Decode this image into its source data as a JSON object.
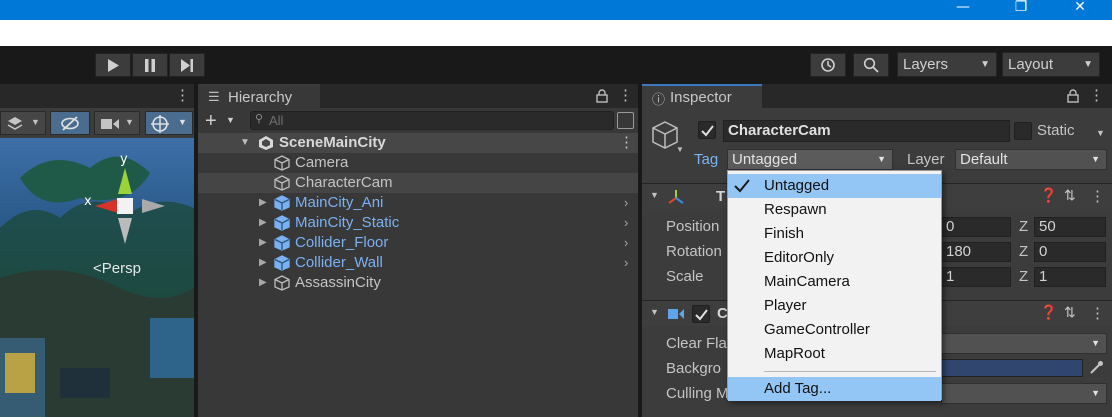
{
  "window": {
    "minimize_glyph": "—",
    "maximize_glyph": "❐",
    "close_glyph": "✕"
  },
  "toolbar": {
    "layers_label": "Layers",
    "layout_label": "Layout"
  },
  "scene": {
    "axis_y": "y",
    "axis_x": "x",
    "persp_label": "<Persp"
  },
  "hierarchy": {
    "tab_label": "Hierarchy",
    "search_placeholder": "All",
    "scene_name": "SceneMainCity",
    "items": [
      {
        "label": "Camera",
        "prefab": false,
        "expandable": false
      },
      {
        "label": "CharacterCam",
        "prefab": false,
        "expandable": false,
        "selected": true
      },
      {
        "label": "MainCity_Ani",
        "prefab": true,
        "expandable": true
      },
      {
        "label": "MainCity_Static",
        "prefab": true,
        "expandable": true
      },
      {
        "label": "Collider_Floor",
        "prefab": true,
        "expandable": true
      },
      {
        "label": "Collider_Wall",
        "prefab": true,
        "expandable": true
      },
      {
        "label": "AssassinCity",
        "prefab": false,
        "expandable": true
      }
    ]
  },
  "inspector": {
    "tab_label": "Inspector",
    "object_name": "CharacterCam",
    "static_label": "Static",
    "tag_label": "Tag",
    "tag_value": "Untagged",
    "layer_label": "Layer",
    "layer_value": "Default",
    "transform": {
      "header_initial": "T",
      "position_label": "Position",
      "rotation_label": "Rotation",
      "scale_label": "Scale",
      "position_y": "0",
      "position_z": "50",
      "rotation_y": "180",
      "rotation_z": "0",
      "scale_y": "1",
      "scale_z": "1",
      "z_label": "Z"
    },
    "camera": {
      "header_initial": "C",
      "clear_flags_label": "Clear Fla",
      "background_label": "Backgro",
      "culling_label": "Culling M"
    }
  },
  "tag_menu": {
    "items": [
      "Untagged",
      "Respawn",
      "Finish",
      "EditorOnly",
      "MainCamera",
      "Player",
      "GameController",
      "MapRoot"
    ],
    "selected_index": 0,
    "add_tag_label": "Add Tag..."
  },
  "colors": {
    "accent": "#0078d7",
    "selection": "#93c6f5",
    "prefab_text": "#7bb1f2"
  }
}
